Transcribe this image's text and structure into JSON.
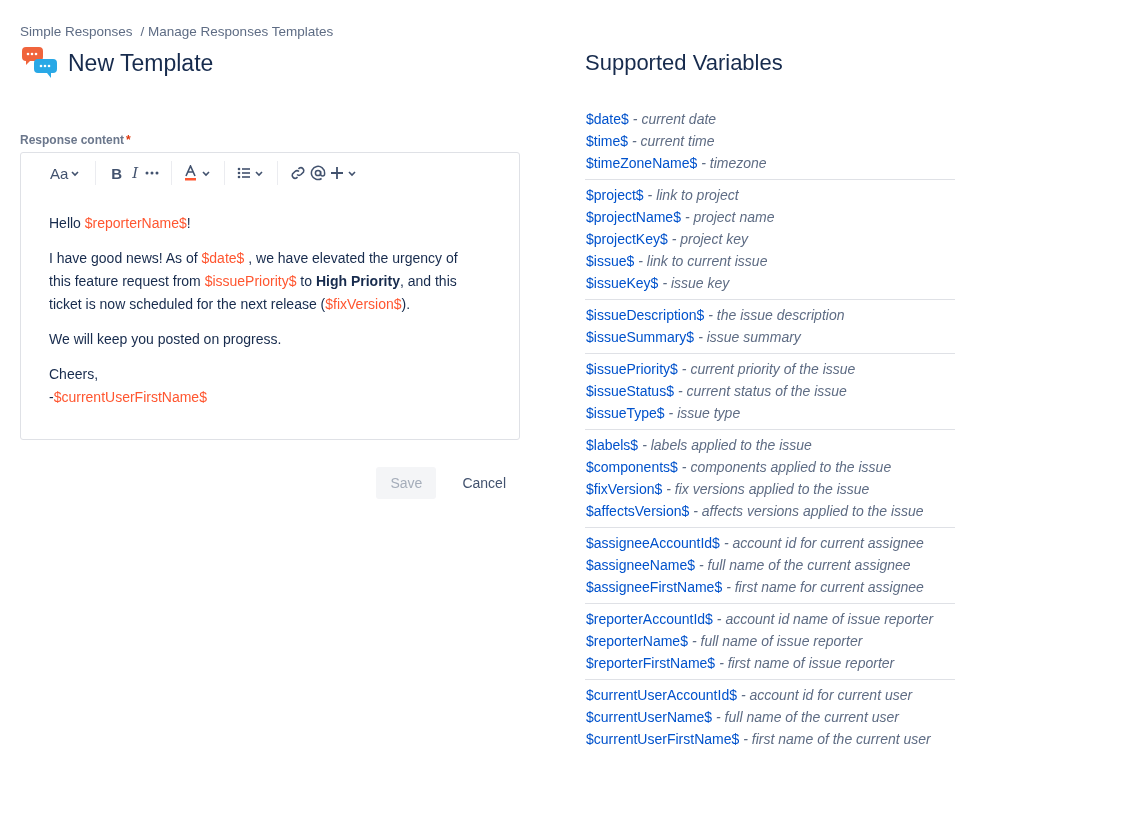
{
  "breadcrumbs": [
    "Simple Responses",
    "/ Manage Responses Templates"
  ],
  "title": "New Template",
  "field": {
    "label": "Response content",
    "required_mark": "*"
  },
  "toolbar": [
    {
      "kind": "text-style",
      "label": "Aa"
    },
    {
      "kind": "sep"
    },
    {
      "kind": "bold",
      "label": "B"
    },
    {
      "kind": "italic",
      "label": "I"
    },
    {
      "kind": "more"
    },
    {
      "kind": "sep"
    },
    {
      "kind": "color"
    },
    {
      "kind": "sep"
    },
    {
      "kind": "list"
    },
    {
      "kind": "sep"
    },
    {
      "kind": "link"
    },
    {
      "kind": "mention"
    },
    {
      "kind": "insert"
    }
  ],
  "paragraphs": [
    [
      {
        "kind": "text",
        "text": "Hello "
      },
      {
        "kind": "var",
        "text": "$reporterName$"
      },
      {
        "kind": "text",
        "text": "!"
      }
    ],
    [
      {
        "kind": "text",
        "text": "I have good news! As of "
      },
      {
        "kind": "var",
        "text": "$date$"
      },
      {
        "kind": "text",
        "text": " , we have elevated the urgency of this feature request from "
      },
      {
        "kind": "var",
        "text": "$issuePriority$"
      },
      {
        "kind": "text",
        "text": "  to "
      },
      {
        "kind": "bold",
        "text": "High Priority"
      },
      {
        "kind": "text",
        "text": ", and this ticket is now scheduled for the next release ("
      },
      {
        "kind": "var",
        "text": "$fixVersion$"
      },
      {
        "kind": "text",
        "text": ")."
      }
    ],
    [
      {
        "kind": "text",
        "text": "We will keep you posted on progress."
      }
    ],
    [
      {
        "kind": "text",
        "text": "Cheers,"
      },
      {
        "kind": "break"
      },
      {
        "kind": "text",
        "text": "-"
      },
      {
        "kind": "var",
        "text": "$currentUserFirstName$"
      }
    ]
  ],
  "buttons": [
    {
      "label": "Save",
      "disabled": true
    },
    {
      "label": "Cancel",
      "disabled": false
    }
  ],
  "variables_title": "Supported Variables",
  "variable_groups": [
    [
      {
        "variable": "$date$",
        "description": "- current date"
      },
      {
        "variable": "$time$",
        "description": "- current time"
      },
      {
        "variable": "$timeZoneName$",
        "description": "- timezone"
      }
    ],
    [
      {
        "variable": "$project$",
        "description": "- link to project"
      },
      {
        "variable": "$projectName$",
        "description": "- project name"
      },
      {
        "variable": "$projectKey$",
        "description": "- project key"
      },
      {
        "variable": "$issue$",
        "description": "- link to current issue"
      },
      {
        "variable": "$issueKey$",
        "description": "- issue key"
      }
    ],
    [
      {
        "variable": "$issueDescription$",
        "description": "- the issue description"
      },
      {
        "variable": "$issueSummary$",
        "description": "- issue summary"
      }
    ],
    [
      {
        "variable": "$issuePriority$",
        "description": "- current priority of the issue"
      },
      {
        "variable": "$issueStatus$",
        "description": "- current status of the issue"
      },
      {
        "variable": "$issueType$",
        "description": "- issue type"
      }
    ],
    [
      {
        "variable": "$labels$",
        "description": "- labels applied to the issue"
      },
      {
        "variable": "$components$",
        "description": "- components applied to the issue"
      },
      {
        "variable": "$fixVersion$",
        "description": "- fix versions applied to the issue"
      },
      {
        "variable": "$affectsVersion$",
        "description": "- affects versions applied to the issue"
      }
    ],
    [
      {
        "variable": "$assigneeAccountId$",
        "description": "- account id for current assignee"
      },
      {
        "variable": "$assigneeName$",
        "description": "- full name of the current assignee"
      },
      {
        "variable": "$assigneeFirstName$",
        "description": "- first name for current assignee"
      }
    ],
    [
      {
        "variable": "$reporterAccountId$",
        "description": "- account id name of issue reporter"
      },
      {
        "variable": "$reporterName$",
        "description": "- full name of issue reporter"
      },
      {
        "variable": "$reporterFirstName$",
        "description": "- first name of issue reporter"
      }
    ],
    [
      {
        "variable": "$currentUserAccountId$",
        "description": "- account id for current user"
      },
      {
        "variable": "$currentUserName$",
        "description": "- full name of the current user"
      },
      {
        "variable": "$currentUserFirstName$",
        "description": "- first name of the current user"
      }
    ]
  ]
}
